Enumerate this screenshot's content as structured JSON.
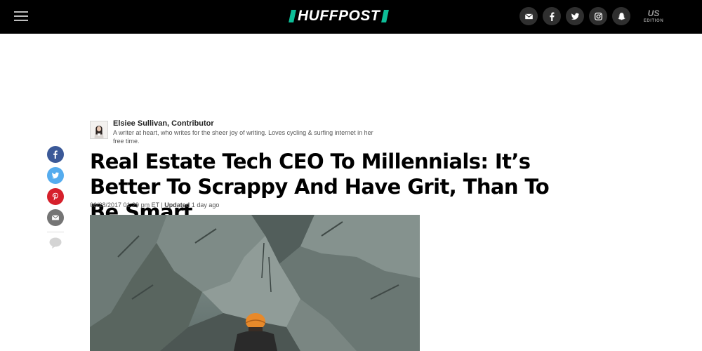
{
  "header": {
    "logo_text": "HUFFPOST",
    "brand_color": "#0dbe98",
    "social_icons": [
      "email-icon",
      "facebook-icon",
      "twitter-icon",
      "instagram-icon",
      "snapchat-icon"
    ],
    "edition": {
      "code": "US",
      "label": "EDITION"
    }
  },
  "author": {
    "name": "Elsiee Sullivan, Contributor",
    "bio": "A writer at heart, who writes for the sheer joy of writing. Loves cycling & surfing internet in her free time."
  },
  "share": {
    "icons": [
      "facebook-icon",
      "twitter-icon",
      "pinterest-icon",
      "email-icon",
      "comment-icon"
    ],
    "colors": {
      "facebook": "#3b5998",
      "twitter": "#55acee",
      "pinterest": "#d6202b",
      "email": "#757575"
    }
  },
  "article": {
    "headline": "Real Estate Tech CEO To Millennials: It’s Better To Scrappy And Have Grit, Than To Be Smart",
    "date": "06/28/2017 01:29 pm ET",
    "separator": "|",
    "updated_label": "Updated",
    "updated_value": "1 day ago"
  }
}
